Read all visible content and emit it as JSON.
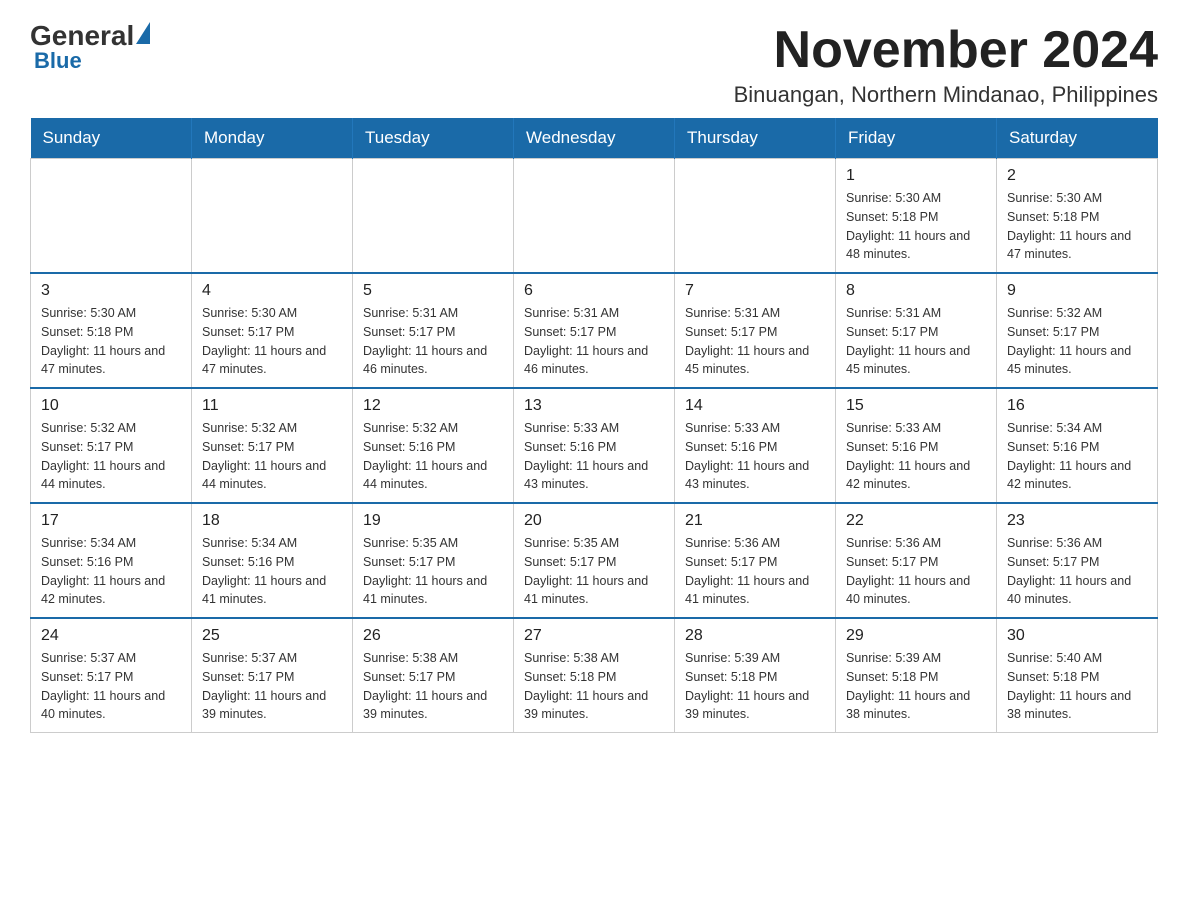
{
  "logo": {
    "general": "General",
    "blue": "Blue"
  },
  "title": "November 2024",
  "subtitle": "Binuangan, Northern Mindanao, Philippines",
  "days_of_week": [
    "Sunday",
    "Monday",
    "Tuesday",
    "Wednesday",
    "Thursday",
    "Friday",
    "Saturday"
  ],
  "weeks": [
    {
      "row_class": "",
      "days": [
        {
          "date": "",
          "info": ""
        },
        {
          "date": "",
          "info": ""
        },
        {
          "date": "",
          "info": ""
        },
        {
          "date": "",
          "info": ""
        },
        {
          "date": "",
          "info": ""
        },
        {
          "date": "1",
          "info": "Sunrise: 5:30 AM\nSunset: 5:18 PM\nDaylight: 11 hours and 48 minutes."
        },
        {
          "date": "2",
          "info": "Sunrise: 5:30 AM\nSunset: 5:18 PM\nDaylight: 11 hours and 47 minutes."
        }
      ]
    },
    {
      "row_class": "row-divider",
      "days": [
        {
          "date": "3",
          "info": "Sunrise: 5:30 AM\nSunset: 5:18 PM\nDaylight: 11 hours and 47 minutes."
        },
        {
          "date": "4",
          "info": "Sunrise: 5:30 AM\nSunset: 5:17 PM\nDaylight: 11 hours and 47 minutes."
        },
        {
          "date": "5",
          "info": "Sunrise: 5:31 AM\nSunset: 5:17 PM\nDaylight: 11 hours and 46 minutes."
        },
        {
          "date": "6",
          "info": "Sunrise: 5:31 AM\nSunset: 5:17 PM\nDaylight: 11 hours and 46 minutes."
        },
        {
          "date": "7",
          "info": "Sunrise: 5:31 AM\nSunset: 5:17 PM\nDaylight: 11 hours and 45 minutes."
        },
        {
          "date": "8",
          "info": "Sunrise: 5:31 AM\nSunset: 5:17 PM\nDaylight: 11 hours and 45 minutes."
        },
        {
          "date": "9",
          "info": "Sunrise: 5:32 AM\nSunset: 5:17 PM\nDaylight: 11 hours and 45 minutes."
        }
      ]
    },
    {
      "row_class": "row-divider",
      "days": [
        {
          "date": "10",
          "info": "Sunrise: 5:32 AM\nSunset: 5:17 PM\nDaylight: 11 hours and 44 minutes."
        },
        {
          "date": "11",
          "info": "Sunrise: 5:32 AM\nSunset: 5:17 PM\nDaylight: 11 hours and 44 minutes."
        },
        {
          "date": "12",
          "info": "Sunrise: 5:32 AM\nSunset: 5:16 PM\nDaylight: 11 hours and 44 minutes."
        },
        {
          "date": "13",
          "info": "Sunrise: 5:33 AM\nSunset: 5:16 PM\nDaylight: 11 hours and 43 minutes."
        },
        {
          "date": "14",
          "info": "Sunrise: 5:33 AM\nSunset: 5:16 PM\nDaylight: 11 hours and 43 minutes."
        },
        {
          "date": "15",
          "info": "Sunrise: 5:33 AM\nSunset: 5:16 PM\nDaylight: 11 hours and 42 minutes."
        },
        {
          "date": "16",
          "info": "Sunrise: 5:34 AM\nSunset: 5:16 PM\nDaylight: 11 hours and 42 minutes."
        }
      ]
    },
    {
      "row_class": "row-divider",
      "days": [
        {
          "date": "17",
          "info": "Sunrise: 5:34 AM\nSunset: 5:16 PM\nDaylight: 11 hours and 42 minutes."
        },
        {
          "date": "18",
          "info": "Sunrise: 5:34 AM\nSunset: 5:16 PM\nDaylight: 11 hours and 41 minutes."
        },
        {
          "date": "19",
          "info": "Sunrise: 5:35 AM\nSunset: 5:17 PM\nDaylight: 11 hours and 41 minutes."
        },
        {
          "date": "20",
          "info": "Sunrise: 5:35 AM\nSunset: 5:17 PM\nDaylight: 11 hours and 41 minutes."
        },
        {
          "date": "21",
          "info": "Sunrise: 5:36 AM\nSunset: 5:17 PM\nDaylight: 11 hours and 41 minutes."
        },
        {
          "date": "22",
          "info": "Sunrise: 5:36 AM\nSunset: 5:17 PM\nDaylight: 11 hours and 40 minutes."
        },
        {
          "date": "23",
          "info": "Sunrise: 5:36 AM\nSunset: 5:17 PM\nDaylight: 11 hours and 40 minutes."
        }
      ]
    },
    {
      "row_class": "row-divider",
      "days": [
        {
          "date": "24",
          "info": "Sunrise: 5:37 AM\nSunset: 5:17 PM\nDaylight: 11 hours and 40 minutes."
        },
        {
          "date": "25",
          "info": "Sunrise: 5:37 AM\nSunset: 5:17 PM\nDaylight: 11 hours and 39 minutes."
        },
        {
          "date": "26",
          "info": "Sunrise: 5:38 AM\nSunset: 5:17 PM\nDaylight: 11 hours and 39 minutes."
        },
        {
          "date": "27",
          "info": "Sunrise: 5:38 AM\nSunset: 5:18 PM\nDaylight: 11 hours and 39 minutes."
        },
        {
          "date": "28",
          "info": "Sunrise: 5:39 AM\nSunset: 5:18 PM\nDaylight: 11 hours and 39 minutes."
        },
        {
          "date": "29",
          "info": "Sunrise: 5:39 AM\nSunset: 5:18 PM\nDaylight: 11 hours and 38 minutes."
        },
        {
          "date": "30",
          "info": "Sunrise: 5:40 AM\nSunset: 5:18 PM\nDaylight: 11 hours and 38 minutes."
        }
      ]
    }
  ]
}
